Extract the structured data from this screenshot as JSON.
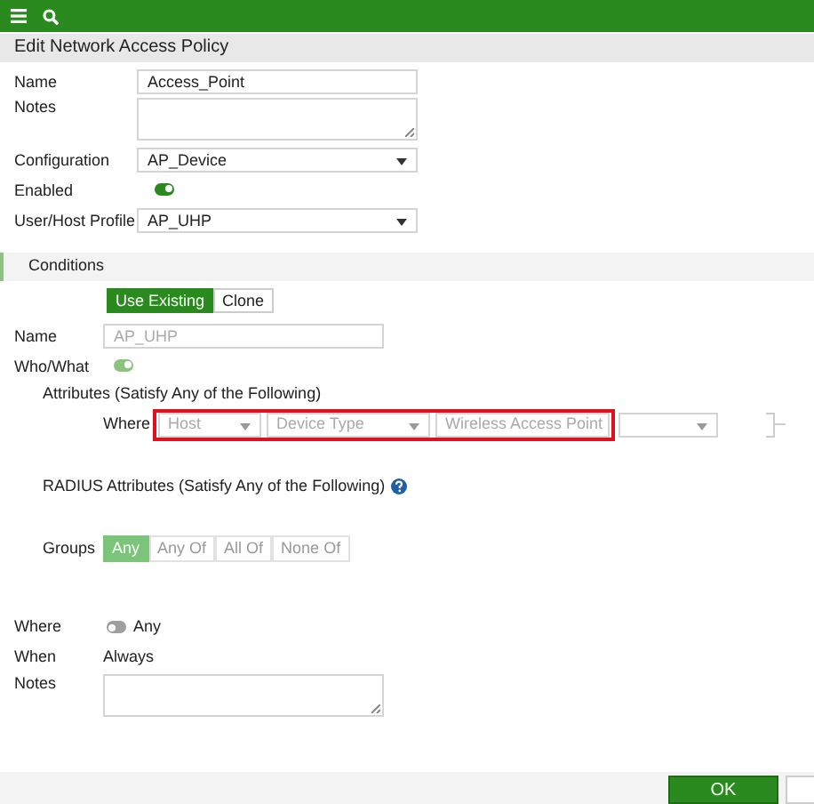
{
  "title": "Edit Network Access Policy",
  "policy_fields": [
    {
      "kind": "text",
      "label": "Name",
      "value": "Access_Point"
    },
    {
      "kind": "textarea",
      "label": "Notes"
    },
    {
      "kind": "select",
      "label": "Configuration",
      "value": "AP_Device"
    },
    {
      "kind": "toggle",
      "label": "Enabled",
      "on": true
    },
    {
      "kind": "select",
      "label": "User/Host Profile",
      "value": "AP_UHP"
    }
  ],
  "conditions": {
    "title": "Conditions",
    "mode_buttons": [
      {
        "label": "Use Existing",
        "selected": true
      },
      {
        "label": "Clone",
        "selected": false
      }
    ],
    "name": {
      "label": "Name",
      "value": "AP_UHP",
      "disabled": true
    },
    "who_what": {
      "label": "Who/What",
      "on": true,
      "disabled": true
    },
    "attributes": {
      "title": "Attributes (Satisfy Any of the Following)",
      "where_label": "Where",
      "fields": [
        {
          "kind": "select",
          "value": "Host",
          "highlighted": true
        },
        {
          "kind": "select",
          "value": "Device Type",
          "highlighted": true
        },
        {
          "kind": "text",
          "value": "Wireless Access Point",
          "highlighted": true
        },
        {
          "kind": "select",
          "highlighted": false
        }
      ]
    },
    "radius_title": "RADIUS Attributes (Satisfy Any of the Following)",
    "groups": {
      "label": "Groups",
      "options": [
        {
          "label": "Any",
          "selected": true
        },
        {
          "label": "Any Of",
          "selected": false
        },
        {
          "label": "All Of",
          "selected": false
        },
        {
          "label": "None Of",
          "selected": false
        }
      ]
    },
    "where": {
      "label": "Where",
      "on": false,
      "text": "Any"
    },
    "when": {
      "label": "When",
      "value": "Always"
    },
    "notes": {
      "label": "Notes"
    }
  },
  "footer": {
    "buttons": [
      {
        "kind": "primary",
        "label": "OK"
      },
      {
        "kind": "secondary"
      }
    ]
  }
}
